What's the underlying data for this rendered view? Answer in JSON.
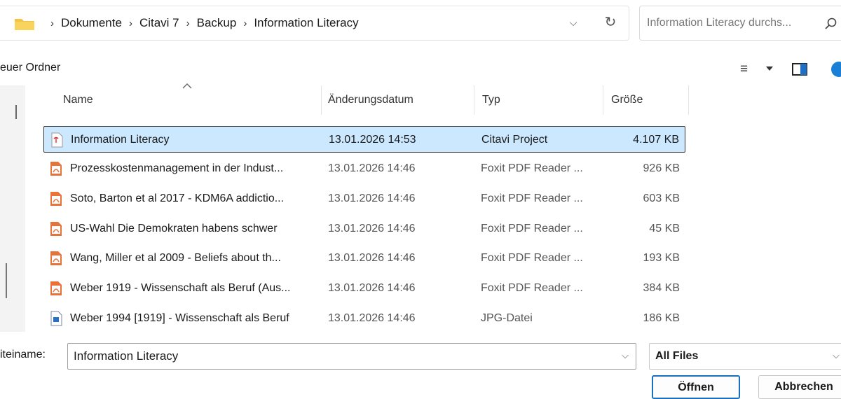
{
  "address_bar": {
    "crumbs": [
      "Dokumente",
      "Citavi 7",
      "Backup",
      "Information Literacy"
    ],
    "separator": "›",
    "dropdown_glyph": "⌵",
    "refresh_glyph": "↻"
  },
  "search": {
    "placeholder": "Information Literacy durchs..."
  },
  "toolbar": {
    "new_folder_label": "euer Ordner",
    "view_glyph": "≡"
  },
  "columns": {
    "name": "Name",
    "date": "Änderungsdatum",
    "type": "Typ",
    "size": "Größe"
  },
  "files": [
    {
      "name": "Information Literacy",
      "date": "13.01.2026 14:53",
      "type": "Citavi Project",
      "size": "4.107 KB",
      "icon": "citavi-project-icon",
      "selected": true
    },
    {
      "name": "Prozesskostenmanagement in der Indust...",
      "date": "13.01.2026 14:46",
      "type": "Foxit PDF Reader ...",
      "size": "926 KB",
      "icon": "pdf-icon",
      "selected": false
    },
    {
      "name": "Soto, Barton et al 2017 - KDM6A addictio...",
      "date": "13.01.2026 14:46",
      "type": "Foxit PDF Reader ...",
      "size": "603 KB",
      "icon": "pdf-icon",
      "selected": false
    },
    {
      "name": "US-Wahl Die Demokraten habens schwer",
      "date": "13.01.2026 14:46",
      "type": "Foxit PDF Reader ...",
      "size": "45 KB",
      "icon": "pdf-icon",
      "selected": false
    },
    {
      "name": "Wang, Miller et al 2009 - Beliefs about th...",
      "date": "13.01.2026 14:46",
      "type": "Foxit PDF Reader ...",
      "size": "193 KB",
      "icon": "pdf-icon",
      "selected": false
    },
    {
      "name": "Weber 1919 - Wissenschaft als Beruf (Aus...",
      "date": "13.01.2026 14:46",
      "type": "Foxit PDF Reader ...",
      "size": "384 KB",
      "icon": "pdf-icon",
      "selected": false
    },
    {
      "name": "Weber 1994 [1919] - Wissenschaft als Beruf",
      "date": "13.01.2026 14:46",
      "type": "JPG-Datei",
      "size": "186 KB",
      "icon": "jpg-file-icon",
      "selected": false
    }
  ],
  "filename": {
    "label": "iteiname:",
    "value": "Information Literacy",
    "dropdown_glyph": "⌵"
  },
  "filter": {
    "value": "All Files",
    "dropdown_glyph": "⌵"
  },
  "buttons": {
    "open": "Öffnen",
    "cancel": "Abbrechen"
  },
  "colors": {
    "selection": "#cce8ff",
    "folder": "#f5c242",
    "pdf": "#e8733a",
    "accent": "#1a7fd6"
  }
}
